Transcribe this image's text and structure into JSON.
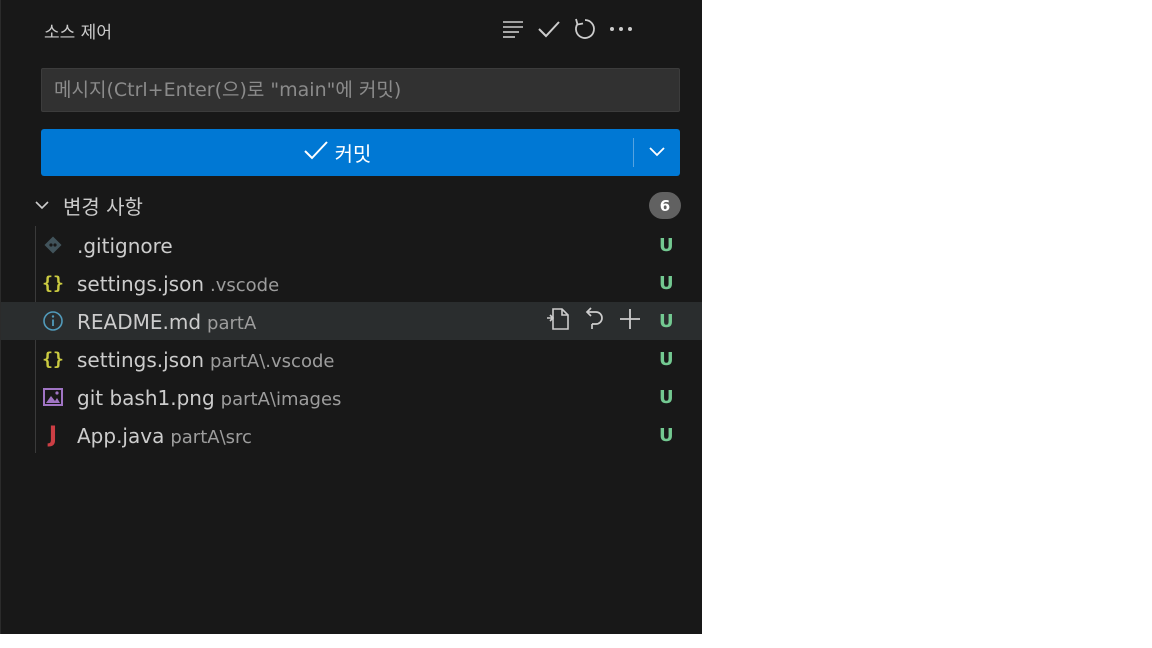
{
  "panel": {
    "title": "소스 제어",
    "toolbar": [
      {
        "name": "view-as-tree",
        "icon": "list-icon"
      },
      {
        "name": "commit",
        "icon": "check-icon"
      },
      {
        "name": "refresh",
        "icon": "refresh-icon"
      },
      {
        "name": "more-actions",
        "icon": "ellipsis-icon"
      }
    ]
  },
  "commit": {
    "message_placeholder": "메시지(Ctrl+Enter(으)로 \"main\"에 커밋)",
    "message_value": "",
    "button_label": "커밋"
  },
  "changes": {
    "label": "변경 사항",
    "count": "6",
    "files": [
      {
        "name": ".gitignore",
        "dir": "",
        "icon": "git-icon",
        "status": "U"
      },
      {
        "name": "settings.json",
        "dir": ".vscode",
        "icon": "json-icon",
        "status": "U"
      },
      {
        "name": "README.md",
        "dir": "partA",
        "icon": "info-icon",
        "status": "U"
      },
      {
        "name": "settings.json",
        "dir": "partA\\.vscode",
        "icon": "json-icon",
        "status": "U"
      },
      {
        "name": "git bash1.png",
        "dir": "partA\\images",
        "icon": "image-icon",
        "status": "U"
      },
      {
        "name": "App.java",
        "dir": "partA\\src",
        "icon": "java-icon",
        "status": "U"
      }
    ]
  },
  "colors": {
    "panel_bg": "#181818",
    "accent": "#0078d4",
    "untracked": "#73c991"
  }
}
